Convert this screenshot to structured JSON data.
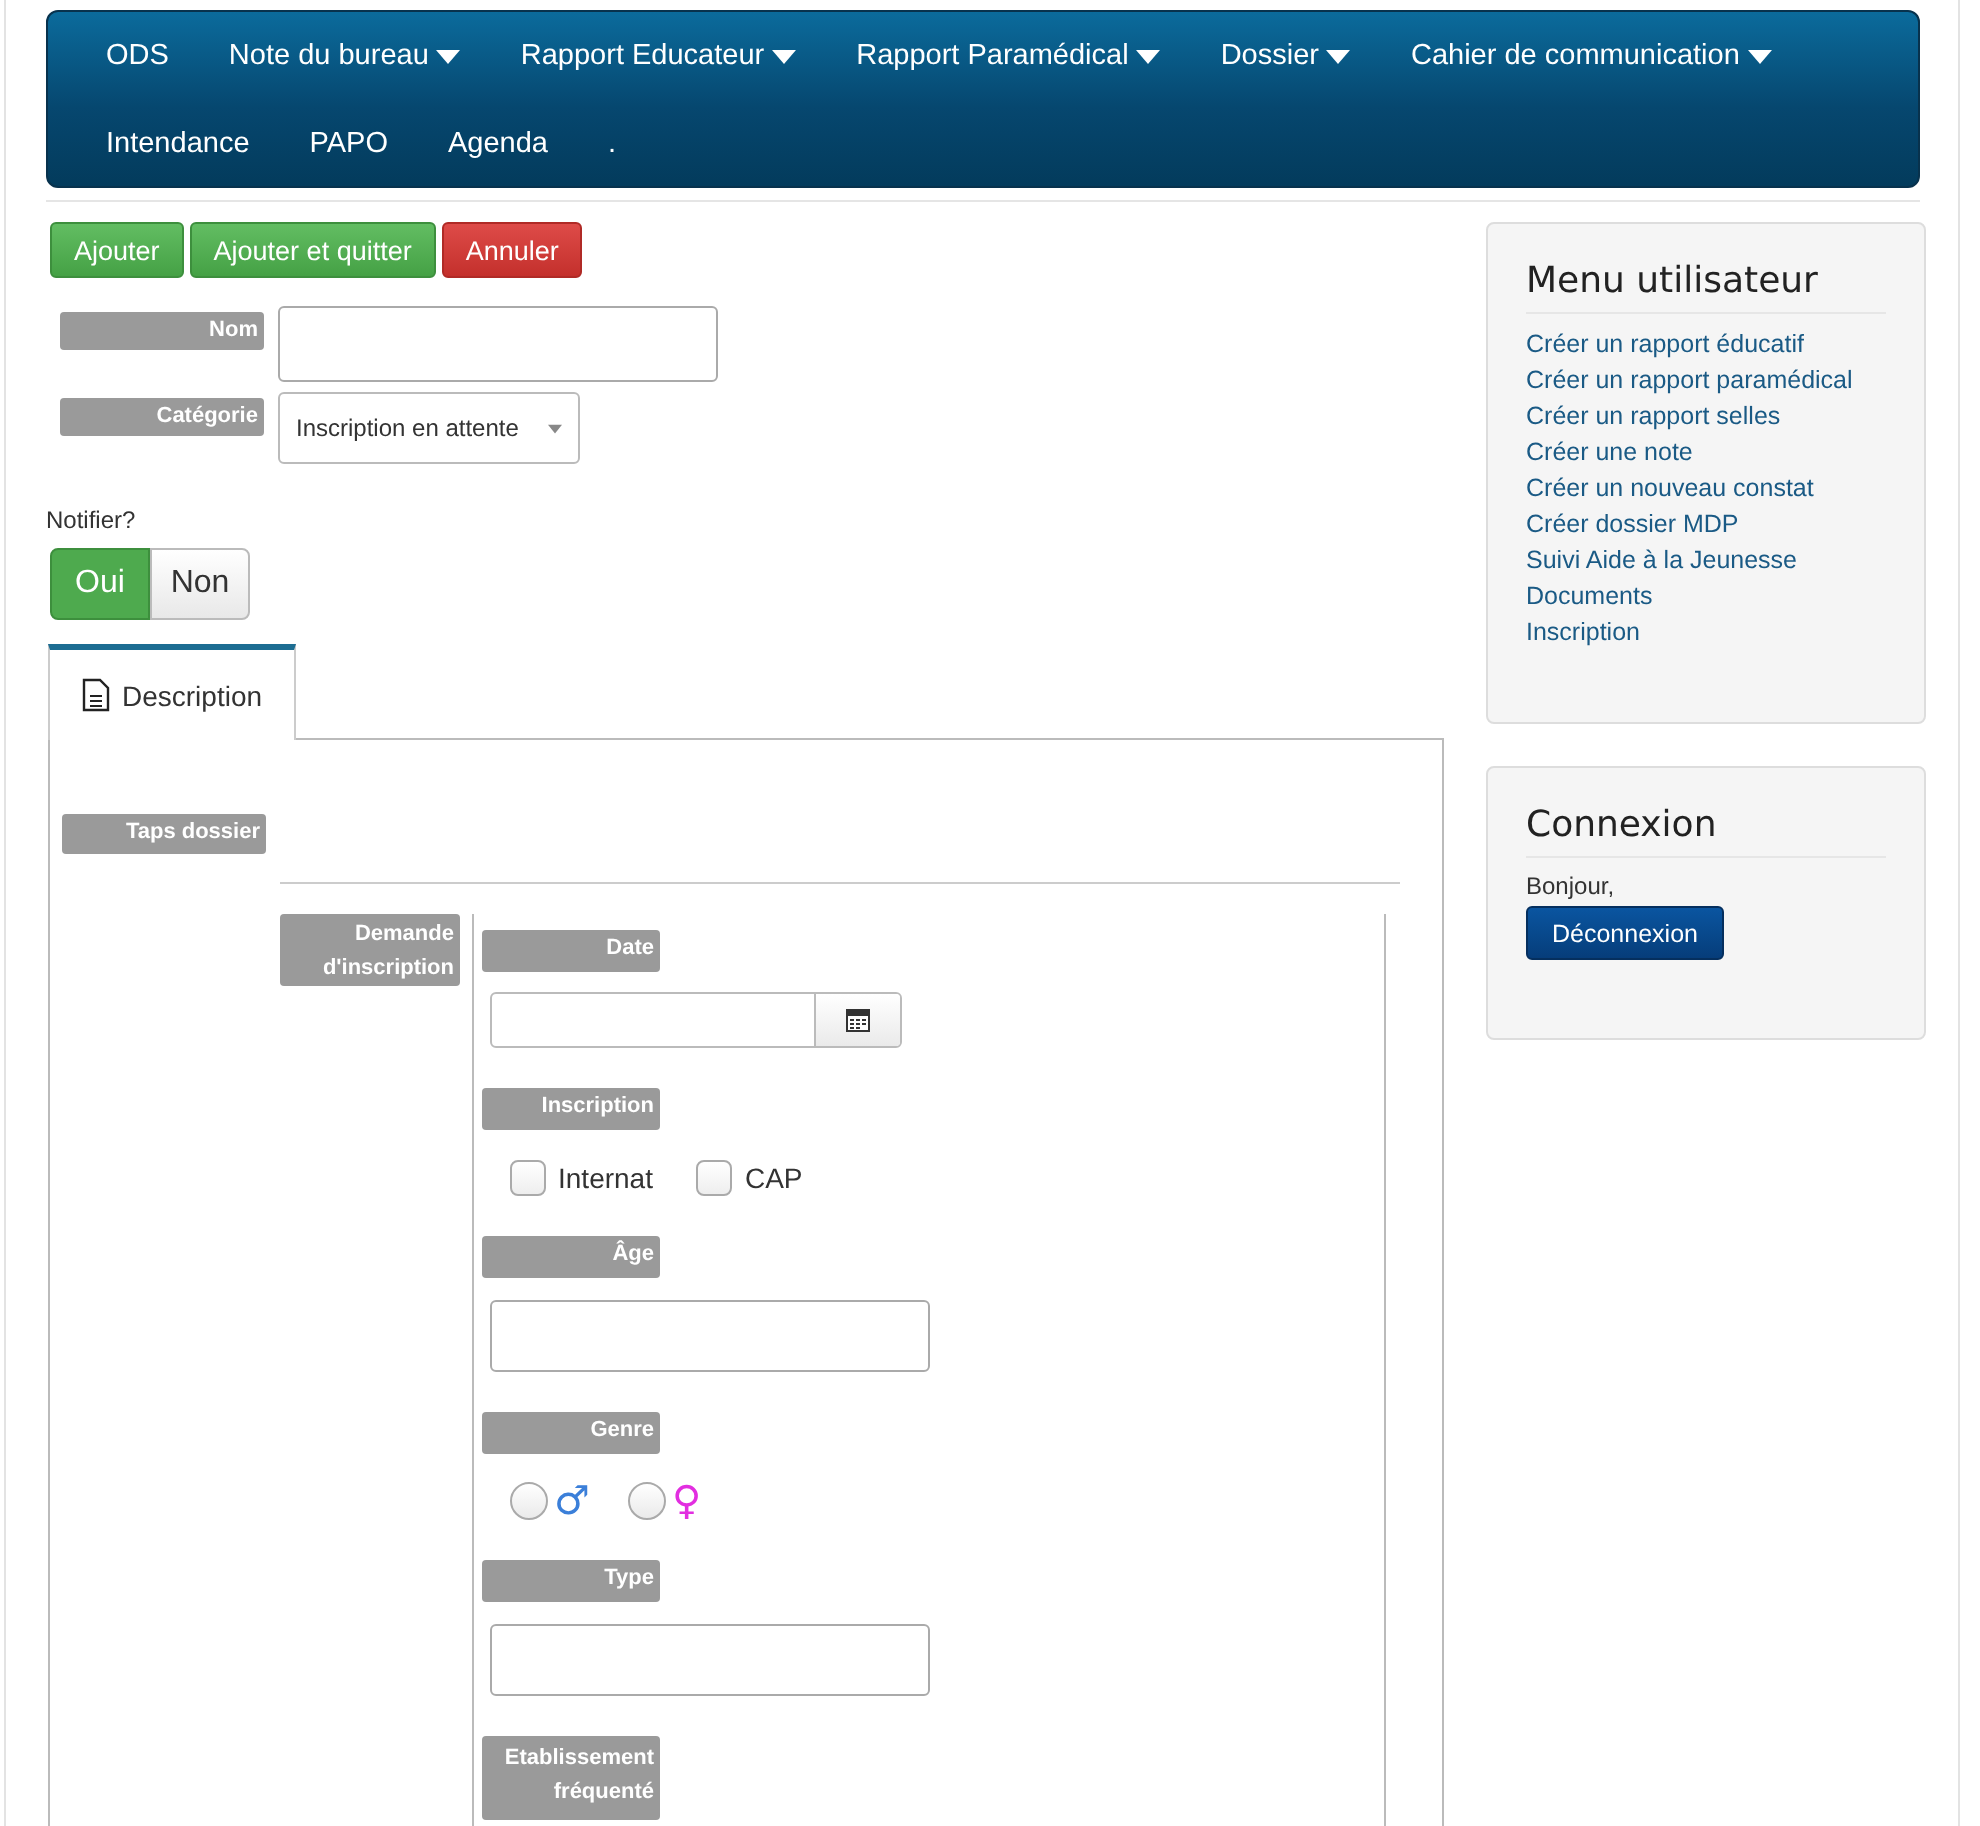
{
  "nav": {
    "items": [
      {
        "label": "ODS",
        "dropdown": false
      },
      {
        "label": "Note du bureau",
        "dropdown": true
      },
      {
        "label": "Rapport Educateur",
        "dropdown": true
      },
      {
        "label": "Rapport Paramédical",
        "dropdown": true
      },
      {
        "label": "Dossier",
        "dropdown": true
      },
      {
        "label": "Cahier de communication",
        "dropdown": true
      },
      {
        "label": "Intendance",
        "dropdown": false
      },
      {
        "label": "PAPO",
        "dropdown": false
      },
      {
        "label": "Agenda",
        "dropdown": false
      },
      {
        "label": ".",
        "dropdown": false
      }
    ]
  },
  "actions": [
    {
      "label": "Ajouter",
      "kind": "success"
    },
    {
      "label": "Ajouter et quitter",
      "kind": "success"
    },
    {
      "label": "Annuler",
      "kind": "danger"
    }
  ],
  "fields": [
    {
      "label": "Nom",
      "kind": "text"
    },
    {
      "label": "Catégorie",
      "kind": "select",
      "value": "Inscription en attente"
    }
  ],
  "notify": {
    "label": "Notifier?",
    "options": [
      {
        "label": "Oui",
        "selected": true
      },
      {
        "label": "Non",
        "selected": false
      }
    ]
  },
  "tabs": [
    {
      "label": "Description",
      "selected": true
    }
  ],
  "panel": {
    "group_label": "Taps dossier",
    "section_label": "Demande d'inscription",
    "items": [
      {
        "label": "Date",
        "kind": "date"
      },
      {
        "label": "Inscription",
        "kind": "checkboxes",
        "options": [
          {
            "label": "Internat",
            "checked": false
          },
          {
            "label": "CAP",
            "checked": false
          }
        ]
      },
      {
        "label": "Âge",
        "kind": "text"
      },
      {
        "label": "Genre",
        "kind": "radios",
        "options": [
          {
            "symbol": "♂",
            "color": "#3b7fd9",
            "selected": false
          },
          {
            "symbol": "♀",
            "color": "#e22ee0",
            "selected": false
          }
        ]
      },
      {
        "label": "Type",
        "kind": "text"
      },
      {
        "label": "Etablissement fréquenté",
        "kind": "label"
      }
    ]
  },
  "sidebar": [
    {
      "title": "Menu utilisateur",
      "links": [
        "Créer un rapport éducatif",
        "Créer un rapport paramédical",
        "Créer un rapport selles",
        "Créer une note",
        "Créer un nouveau constat",
        "Créer dossier MDP",
        "Suivi Aide à la Jeunesse",
        "Documents",
        "Inscription"
      ]
    },
    {
      "title": "Connexion",
      "text": "Bonjour,",
      "button": "Déconnexion"
    }
  ]
}
